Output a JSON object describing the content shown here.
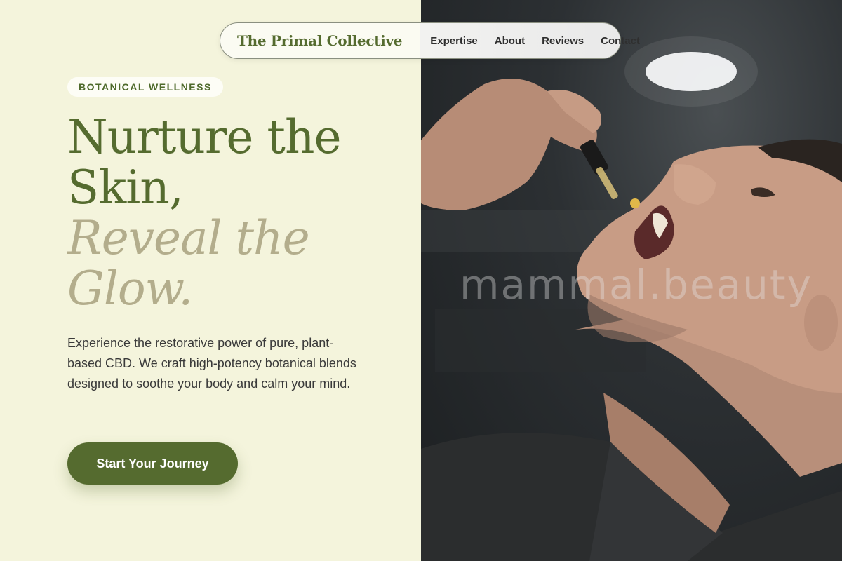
{
  "brand": "The Primal Collective",
  "nav": {
    "links": [
      "Expertise",
      "About",
      "Reviews",
      "Contact"
    ]
  },
  "hero": {
    "badge": "BOTANICAL WELLNESS",
    "headline_line1": "Nurture the",
    "headline_line2": "Skin,",
    "headline_em1": "Reveal the",
    "headline_em2": "Glow.",
    "description": "Experience the restorative power of pure, plant-based CBD. We craft high-potency botanical blends designed to soothe your body and calm your mind.",
    "cta_label": "Start Your Journey"
  },
  "image": {
    "watermark": "mammal.beauty",
    "subject": "man applying CBD oil dropper into mouth"
  },
  "colors": {
    "background": "#f4f4dc",
    "brand_green": "#556b2f",
    "muted_italic": "#b3ad8c",
    "text": "#3a3a3a"
  }
}
